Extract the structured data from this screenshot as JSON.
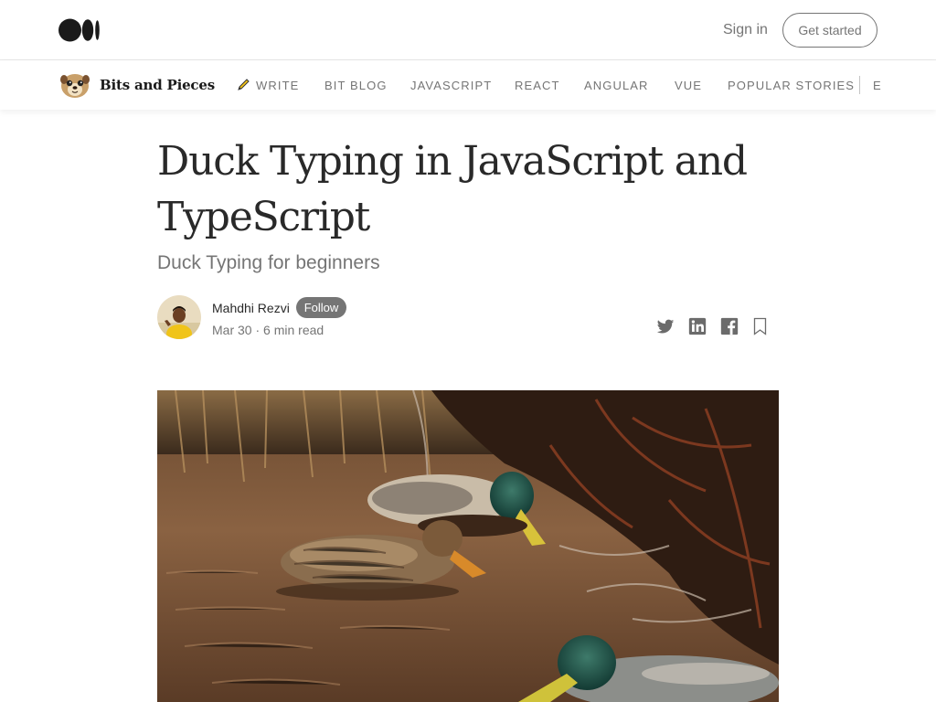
{
  "header": {
    "logo_icon": "medium-logo-icon",
    "signin_label": "Sign in",
    "get_started_label": "Get started"
  },
  "publication": {
    "name": "Bits and Pieces",
    "avatar_icon": "meerkat-avatar",
    "nav": [
      {
        "label": "WRITE",
        "icon": "pencil-icon"
      },
      {
        "label": "BIT BLOG"
      },
      {
        "label": "JAVASCRIPT"
      },
      {
        "label": "REACT"
      },
      {
        "label": "ANGULAR"
      },
      {
        "label": "VUE"
      },
      {
        "label": "POPULAR STORIES"
      },
      {
        "label": "E"
      }
    ]
  },
  "article": {
    "title": "Duck Typing in JavaScript and TypeScript",
    "subtitle": "Duck Typing for beginners",
    "author": "Mahdhi Rezvi",
    "follow_label": "Follow",
    "date": "Mar 30",
    "separator": "·",
    "read_time": "6 min read",
    "share_icons": [
      "twitter-icon",
      "linkedin-icon",
      "facebook-icon",
      "bookmark-icon"
    ],
    "hero_image": "ducks-in-water-photo"
  },
  "colors": {
    "text": "#292929",
    "muted": "#757575",
    "border": "#e6e6e6"
  }
}
